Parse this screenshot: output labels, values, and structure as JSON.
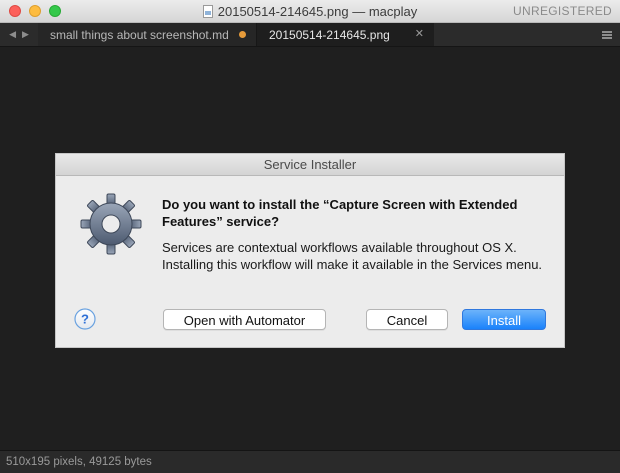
{
  "window": {
    "title": "20150514-214645.png — macplay",
    "license_status": "UNREGISTERED"
  },
  "tabs": [
    {
      "label": "small things about screenshot.md",
      "modified": true,
      "active": false
    },
    {
      "label": "20150514-214645.png",
      "modified": false,
      "active": true
    }
  ],
  "dialog": {
    "title": "Service Installer",
    "heading": "Do you want to install the “Capture Screen with Extended Features” service?",
    "body": "Services are contextual workflows available throughout OS X. Installing this workflow will make it available in the Services menu.",
    "buttons": {
      "open_automator": "Open with Automator",
      "cancel": "Cancel",
      "install": "Install"
    },
    "icons": [
      "gear-icon",
      "help-icon"
    ]
  },
  "status": {
    "text": "510x195 pixels, 49125 bytes"
  },
  "colors": {
    "accent_blue": "#1a82fb",
    "modified_dot": "#e69b3a",
    "editor_bg": "#1f1f1f"
  }
}
